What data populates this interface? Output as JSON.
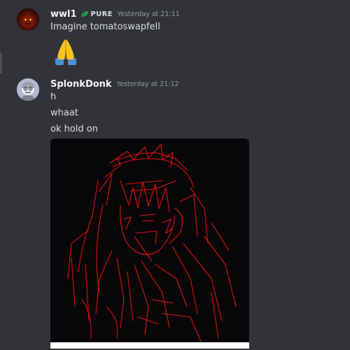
{
  "messages": [
    {
      "username": "wwl1",
      "badge": "PURE",
      "timestamp": "Yesterday at 21:11",
      "lines": [
        "Imagine tomatoswapfell"
      ],
      "emoji": "folded-hands-emoji",
      "avatar_icon": "red-creature-avatar"
    },
    {
      "username": "SplonkDonk",
      "timestamp": "Yesterday at 21:12",
      "lines": [
        "h",
        "whaat",
        "ok hold on"
      ],
      "attachment": "red-line-sketch-image",
      "avatar_icon": "grey-character-avatar"
    }
  ],
  "colors": {
    "background": "#313338",
    "username": "#f2f3f5",
    "text": "#dbdee1",
    "timestamp": "#949ba4",
    "badge_leaf": "#23a55a",
    "sketch_stroke": "#e0110e"
  }
}
